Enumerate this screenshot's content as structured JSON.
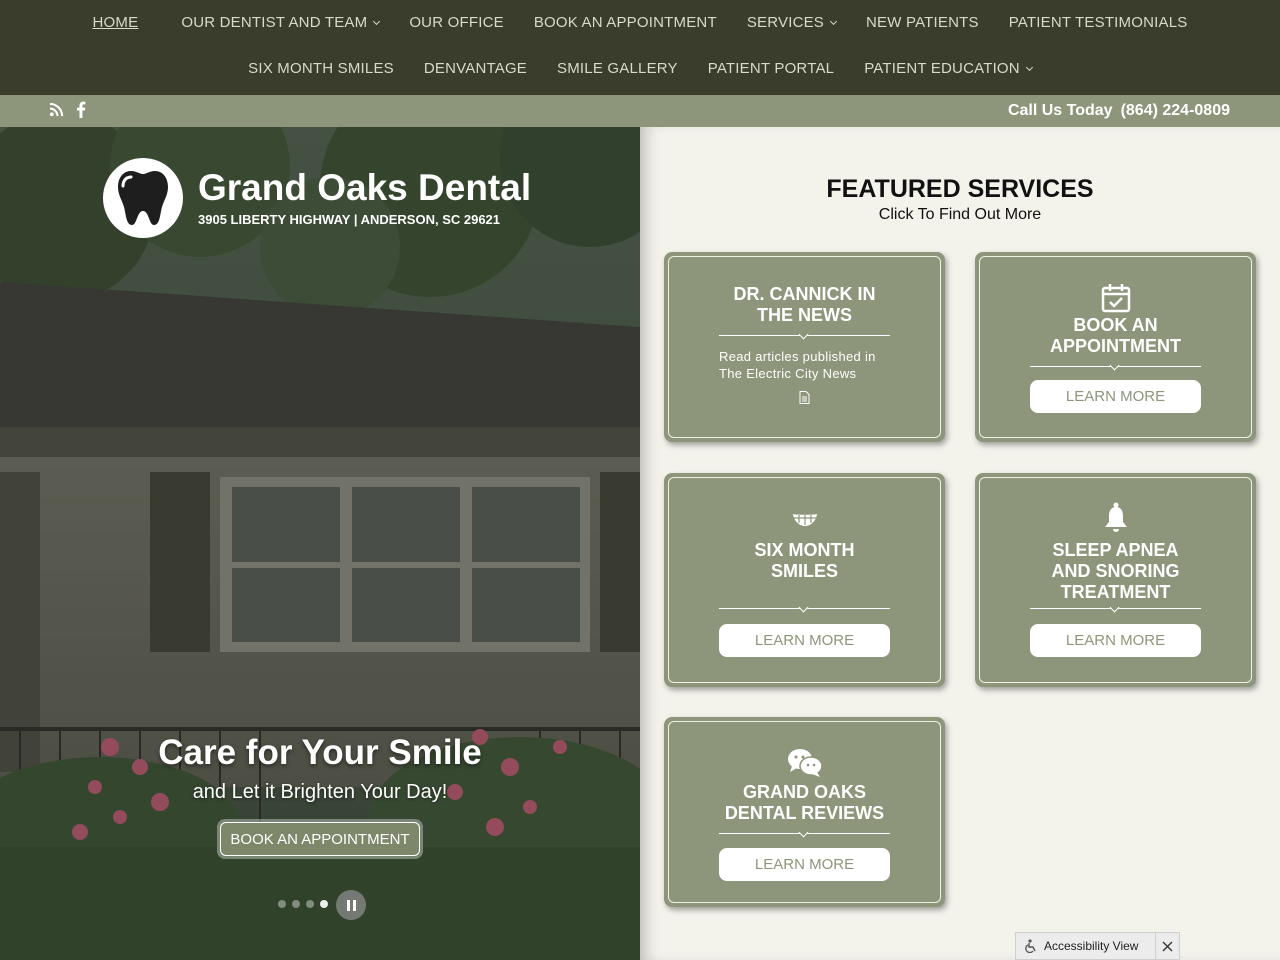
{
  "nav": {
    "row1": [
      {
        "label": "HOME",
        "dropdown": false
      },
      {
        "label": "OUR DENTIST AND TEAM",
        "dropdown": true
      },
      {
        "label": "OUR OFFICE",
        "dropdown": false
      },
      {
        "label": "BOOK AN APPOINTMENT",
        "dropdown": false
      },
      {
        "label": "SERVICES",
        "dropdown": true
      },
      {
        "label": "NEW PATIENTS",
        "dropdown": false
      },
      {
        "label": "PATIENT TESTIMONIALS",
        "dropdown": false
      }
    ],
    "row2": [
      {
        "label": "SIX MONTH SMILES",
        "dropdown": false
      },
      {
        "label": "DENVANTAGE",
        "dropdown": false
      },
      {
        "label": "SMILE GALLERY",
        "dropdown": false
      },
      {
        "label": "PATIENT PORTAL",
        "dropdown": false
      },
      {
        "label": "PATIENT EDUCATION",
        "dropdown": true
      }
    ]
  },
  "infobar": {
    "social_icons": [
      "rss-icon",
      "facebook-icon"
    ],
    "call_label": "Call Us Today",
    "phone": "(864) 224-0809"
  },
  "hero": {
    "brand_name": "Grand Oaks Dental",
    "address": "3905 LIBERTY HIGHWAY | ANDERSON, SC 29621",
    "headline": "Care for Your Smile",
    "subheadline": "and Let it Brighten Your Day!",
    "cta": "BOOK AN APPOINTMENT",
    "slides_count": 4,
    "active_slide": 4
  },
  "featured": {
    "title": "FEATURED SERVICES",
    "subtitle": "Click To Find Out More",
    "cards": [
      {
        "title": "DR. CANNICK IN THE NEWS",
        "title_lines": [
          "DR. CANNICK IN",
          "THE NEWS"
        ],
        "description": "Read articles published in The Electric City News",
        "icon": "document-icon"
      },
      {
        "title_lines": [
          "BOOK AN",
          "APPOINTMENT"
        ],
        "button": "LEARN MORE",
        "icon": "calendar-check-icon"
      },
      {
        "title_lines": [
          "SIX MONTH",
          "SMILES"
        ],
        "button": "LEARN MORE",
        "icon": "braces-smile-icon"
      },
      {
        "title_lines": [
          "SLEEP APNEA",
          "AND SNORING",
          "TREATMENT"
        ],
        "button": "LEARN MORE",
        "icon": "bell-icon"
      },
      {
        "title_lines": [
          "GRAND OAKS",
          "DENTAL REVIEWS"
        ],
        "button": "LEARN MORE",
        "icon": "chat-bubbles-icon"
      }
    ]
  },
  "accessibility": {
    "label": "Accessibility View",
    "icon": "accessibility-icon",
    "close_icon": "close-icon"
  },
  "colors": {
    "nav_bg": "#3a3c2c",
    "accent_olive": "#8d967a",
    "page_bg": "#f3f2eb"
  }
}
